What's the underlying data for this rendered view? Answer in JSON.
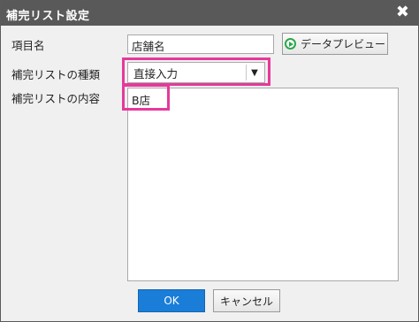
{
  "window": {
    "title": "補完リスト設定",
    "close_glyph": "✖"
  },
  "fields": {
    "item_name": {
      "label": "項目名",
      "value": "店舗名"
    },
    "list_type": {
      "label": "補完リストの種類",
      "value": "直接入力"
    },
    "list_content": {
      "label": "補完リストの内容",
      "value": "B店"
    }
  },
  "buttons": {
    "preview": "データプレビュー",
    "ok": "OK",
    "cancel": "キャンセル"
  },
  "colors": {
    "highlight": "#e6399b",
    "ok_bg": "#1a7ed8",
    "preview_icon": "#2aa84a"
  }
}
